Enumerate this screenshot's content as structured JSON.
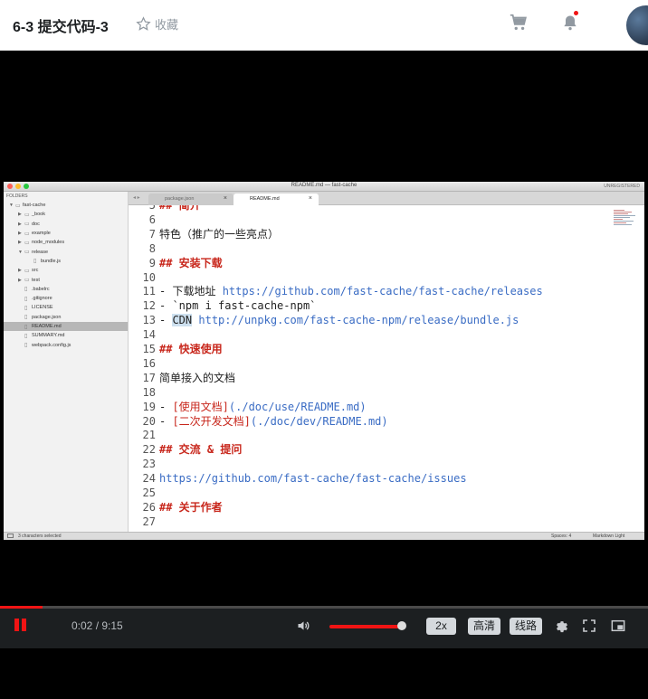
{
  "header": {
    "title": "6-3 提交代码-3",
    "favorite_label": "收藏"
  },
  "editor": {
    "window_title": "README.md — fast-cache",
    "unregistered": "UNREGISTERED",
    "sidebar_heading": "FOLDERS",
    "tree": [
      {
        "label": "fast-cache",
        "level": 0,
        "arrow": "▼",
        "icon": "folder-open-icon"
      },
      {
        "label": "_book",
        "level": 1,
        "arrow": "▶",
        "icon": "folder-icon"
      },
      {
        "label": "doc",
        "level": 1,
        "arrow": "▶",
        "icon": "folder-icon"
      },
      {
        "label": "example",
        "level": 1,
        "arrow": "▶",
        "icon": "folder-icon"
      },
      {
        "label": "node_modules",
        "level": 1,
        "arrow": "▶",
        "icon": "folder-icon"
      },
      {
        "label": "release",
        "level": 1,
        "arrow": "▼",
        "icon": "folder-open-icon"
      },
      {
        "label": "bundle.js",
        "level": 2,
        "arrow": "",
        "icon": "file-icon"
      },
      {
        "label": "src",
        "level": 1,
        "arrow": "▶",
        "icon": "folder-icon"
      },
      {
        "label": "test",
        "level": 1,
        "arrow": "▶",
        "icon": "folder-icon"
      },
      {
        "label": ".babelrc",
        "level": 1,
        "arrow": "",
        "icon": "file-icon"
      },
      {
        "label": ".gitignore",
        "level": 1,
        "arrow": "",
        "icon": "file-icon"
      },
      {
        "label": "LICENSE",
        "level": 1,
        "arrow": "",
        "icon": "file-icon"
      },
      {
        "label": "package.json",
        "level": 1,
        "arrow": "",
        "icon": "file-icon"
      },
      {
        "label": "README.md",
        "level": 1,
        "arrow": "",
        "icon": "file-icon",
        "selected": true
      },
      {
        "label": "SUMMARY.md",
        "level": 1,
        "arrow": "",
        "icon": "file-icon"
      },
      {
        "label": "webpack.config.js",
        "level": 1,
        "arrow": "",
        "icon": "file-icon"
      }
    ],
    "tabs": [
      {
        "label": "package.json",
        "active": false
      },
      {
        "label": "README.md",
        "active": true
      }
    ],
    "lines": [
      {
        "n": "5",
        "text": "## 简介",
        "style": "h"
      },
      {
        "n": "6",
        "text": ""
      },
      {
        "n": "7",
        "text": "特色（推广的一些亮点）"
      },
      {
        "n": "8",
        "text": ""
      },
      {
        "n": "9",
        "text": "## 安装下载",
        "style": "h"
      },
      {
        "n": "10",
        "text": ""
      },
      {
        "n": "11",
        "pre": "- 下载地址 ",
        "link": "https://github.com/fast-cache/fast-cache/releases"
      },
      {
        "n": "12",
        "text": "- `npm i fast-cache-npm`"
      },
      {
        "n": "13",
        "pre": "- ",
        "sel": "CDN",
        "mid": " ",
        "link": "http://unpkg.com/fast-cache-npm/release/bundle.js"
      },
      {
        "n": "14",
        "text": ""
      },
      {
        "n": "15",
        "text": "## 快速使用",
        "style": "h"
      },
      {
        "n": "16",
        "text": ""
      },
      {
        "n": "17",
        "text": "简单接入的文档"
      },
      {
        "n": "18",
        "text": ""
      },
      {
        "n": "19",
        "pre": "- ",
        "br": "[使用文档]",
        "link": "(./doc/use/README.md)"
      },
      {
        "n": "20",
        "pre": "- ",
        "br": "[二次开发文档]",
        "link": "(./doc/dev/README.md)"
      },
      {
        "n": "21",
        "text": ""
      },
      {
        "n": "22",
        "text": "## 交流 & 提问",
        "style": "h"
      },
      {
        "n": "23",
        "text": ""
      },
      {
        "n": "24",
        "text": "https://github.com/fast-cache/fast-cache/issues",
        "style": "u"
      },
      {
        "n": "25",
        "text": ""
      },
      {
        "n": "26",
        "text": "## 关于作者",
        "style": "h"
      },
      {
        "n": "27",
        "text": ""
      }
    ],
    "status": {
      "selection": "3 characters selected",
      "spaces": "Spaces: 4",
      "syntax": "Markdown Light"
    }
  },
  "player": {
    "time": "0:02 / 9:15",
    "progress_fraction": 0.0036,
    "volume_fraction": 1.0,
    "speed_label": "2x",
    "quality_label": "高清",
    "line_label": "线路"
  },
  "colors": {
    "accent": "#f01414",
    "control_bar": "#1c1f21",
    "markdown_heading": "#c8271c",
    "markdown_link": "#3a6cc4"
  }
}
